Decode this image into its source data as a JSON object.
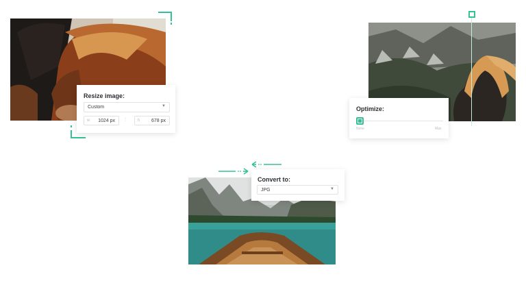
{
  "colors": {
    "accent": "#35c196",
    "text": "#2c2f33",
    "muted": "#b7bcc0"
  },
  "resize": {
    "title": "Resize image:",
    "preset": "Custom",
    "width_label": "w",
    "width_value": "1024 px",
    "height_label": "h",
    "height_value": "678 px"
  },
  "optimize": {
    "title": "Optimize:",
    "level": 0,
    "min_label": "None",
    "max_label": "Max"
  },
  "convert": {
    "title": "Convert to:",
    "format": "JPG"
  },
  "icons": {
    "select_chevron": "chevron-down-icon",
    "link": "link-icon",
    "arrow_right": "arrow-right-icon",
    "arrow_left": "arrow-left-icon"
  }
}
